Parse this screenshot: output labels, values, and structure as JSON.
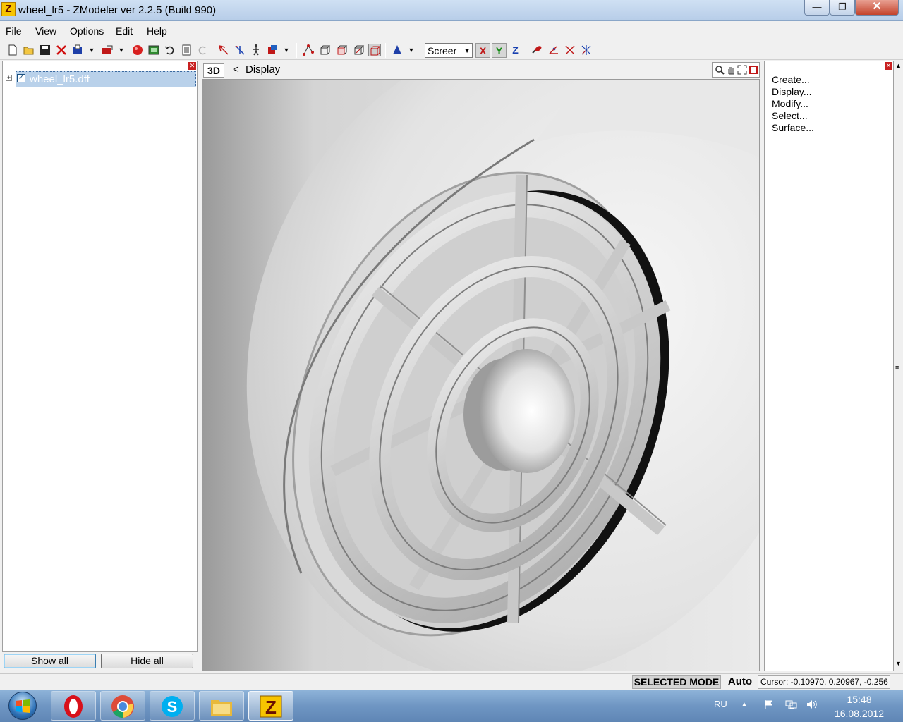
{
  "window": {
    "title": "wheel_lr5 - ZModeler ver 2.2.5 (Build 990)",
    "app_icon_letter": "Z",
    "minimize_glyph": "—",
    "restore_glyph": "❐",
    "close_glyph": "✕"
  },
  "menu": {
    "file": "File",
    "view": "View",
    "options": "Options",
    "edit": "Edit",
    "help": "Help"
  },
  "toolbar": {
    "view_combo_value": "Screer",
    "axis_x": "X",
    "axis_y": "Y",
    "axis_z": "Z"
  },
  "tree": {
    "items": [
      {
        "label": "wheel_lr5.dff",
        "expand_glyph": "+",
        "checked_glyph": "✓"
      }
    ],
    "close_glyph": "✕",
    "show_all": "Show all",
    "hide_all": "Hide all"
  },
  "viewport": {
    "mode_label": "3D",
    "back_glyph": "<",
    "title": "Display"
  },
  "command_panel": {
    "items": [
      "Create...",
      "Display...",
      "Modify...",
      "Select...",
      "Surface..."
    ],
    "close_glyph": "✕"
  },
  "status": {
    "mode": "SELECTED MODE",
    "auto": "Auto",
    "cursor": "Cursor: -0.10970, 0.20967, -0.256"
  },
  "taskbar": {
    "apps": [
      "opera",
      "chrome",
      "skype",
      "explorer",
      "zmodeler"
    ],
    "active_app": "zmodeler"
  },
  "tray": {
    "language": "RU",
    "time": "15:48",
    "date": "16.08.2012"
  },
  "colors": {
    "selection": "#b9d1ea",
    "close_red": "#c82020",
    "taskbar": "#6f96c3"
  }
}
